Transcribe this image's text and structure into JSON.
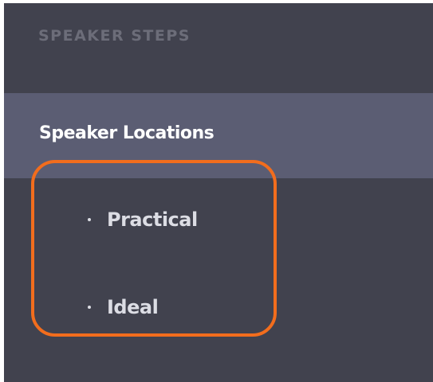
{
  "nav": {
    "section_title": "SPEAKER STEPS",
    "group": {
      "label": "Speaker Locations",
      "items": [
        {
          "label": "Practical"
        },
        {
          "label": "Ideal"
        }
      ]
    }
  },
  "colors": {
    "panel_bg": "#41424e",
    "active_row_bg": "#5b5d73",
    "highlight_outline": "#f26d1d",
    "header_text": "#6c6d79",
    "item_text": "#dcdde4"
  }
}
